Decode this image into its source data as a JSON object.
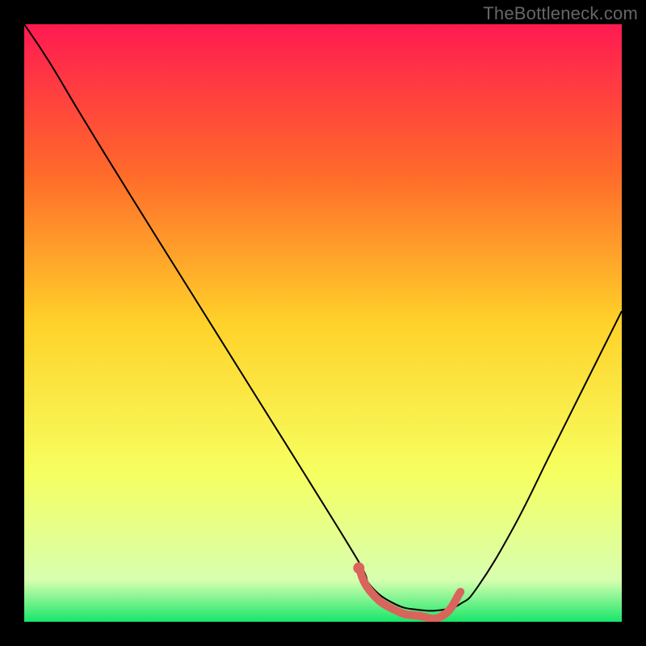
{
  "watermark": "TheBottleneck.com",
  "chart_data": {
    "type": "line",
    "title": "",
    "xlabel": "",
    "ylabel": "",
    "xlim": [
      0,
      100
    ],
    "ylim": [
      0,
      100
    ],
    "gradient_stops": [
      {
        "offset": 0,
        "color": "#ff1a52"
      },
      {
        "offset": 25,
        "color": "#ff6a2a"
      },
      {
        "offset": 50,
        "color": "#ffd22a"
      },
      {
        "offset": 75,
        "color": "#f6ff60"
      },
      {
        "offset": 93,
        "color": "#d8ffb0"
      },
      {
        "offset": 100,
        "color": "#18e66a"
      }
    ],
    "series": [
      {
        "name": "bottleneck-curve",
        "x": [
          0,
          4,
          10,
          18,
          28,
          38,
          48,
          56,
          58,
          62,
          66,
          70,
          73,
          76,
          82,
          88,
          94,
          100
        ],
        "values": [
          100,
          94,
          84,
          71,
          55,
          39,
          23,
          10,
          6,
          3,
          2,
          2,
          3,
          6,
          16,
          28,
          40,
          52
        ]
      }
    ],
    "highlight": {
      "name": "optimal-range",
      "color": "#d9645b",
      "x": [
        56,
        58,
        62,
        66,
        70,
        73
      ],
      "values": [
        9,
        5,
        2,
        1,
        1,
        5
      ]
    }
  }
}
